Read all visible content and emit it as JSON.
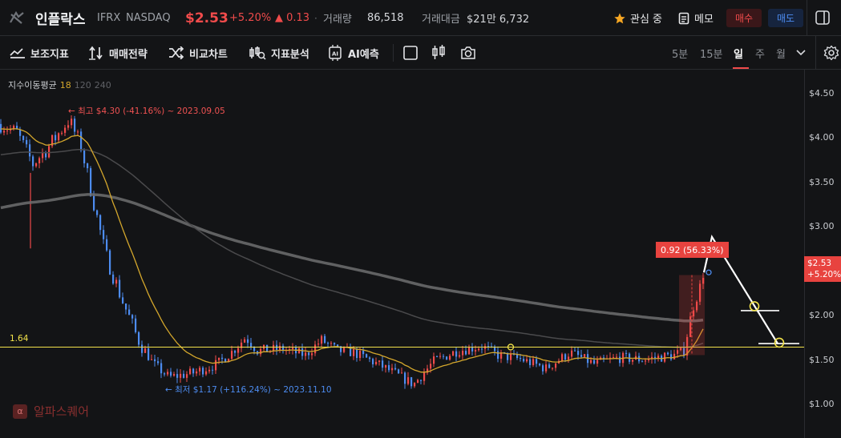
{
  "header": {
    "name": "인플락스",
    "ticker": "IFRX",
    "exchange": "NASDAQ",
    "price": "$2.53",
    "change_pct": "+5.20%",
    "change_abs": "▲ 0.13",
    "separator": "·",
    "volume_label": "거래량",
    "volume_value": "86,518",
    "amount_label": "거래대금",
    "amount_value": "$21만 6,732",
    "watch_label": "관심 중",
    "memo_label": "메모",
    "buy_label": "매수",
    "sell_label": "매도"
  },
  "toolbar": {
    "indicators": "보조지표",
    "strategy": "매매전략",
    "compare": "비교차트",
    "analysis": "지표분석",
    "ai": "AI예측",
    "timeframes": [
      "5분",
      "15분",
      "일",
      "주",
      "월"
    ],
    "active_timeframe": "일"
  },
  "chart": {
    "ma_label": "지수이동평균",
    "ma_periods": [
      "18",
      "120",
      "240"
    ],
    "high_note": "최고 $4.30 (-41.16%) ~ 2023.09.05",
    "low_note": "최저 $1.17 (+116.24%) ~ 2023.11.10",
    "hline_value": "1.64",
    "range_label": "0.92  (56.33%)",
    "current_price": "$2.53",
    "current_change": "+5.20%",
    "y_ticks": [
      "$4.50",
      "$4.00",
      "$3.50",
      "$3.00",
      "$2.50",
      "$2.00",
      "$1.50",
      "$1.00"
    ],
    "watermark": "알파스퀘어"
  },
  "colors": {
    "up": "#f04b4b",
    "down": "#4d8cf0",
    "ma18": "#d4a72c",
    "ma120": "#5a5a5a",
    "ma240": "#7a7a7a",
    "hline": "#f2e24a",
    "background": "#131416"
  }
}
